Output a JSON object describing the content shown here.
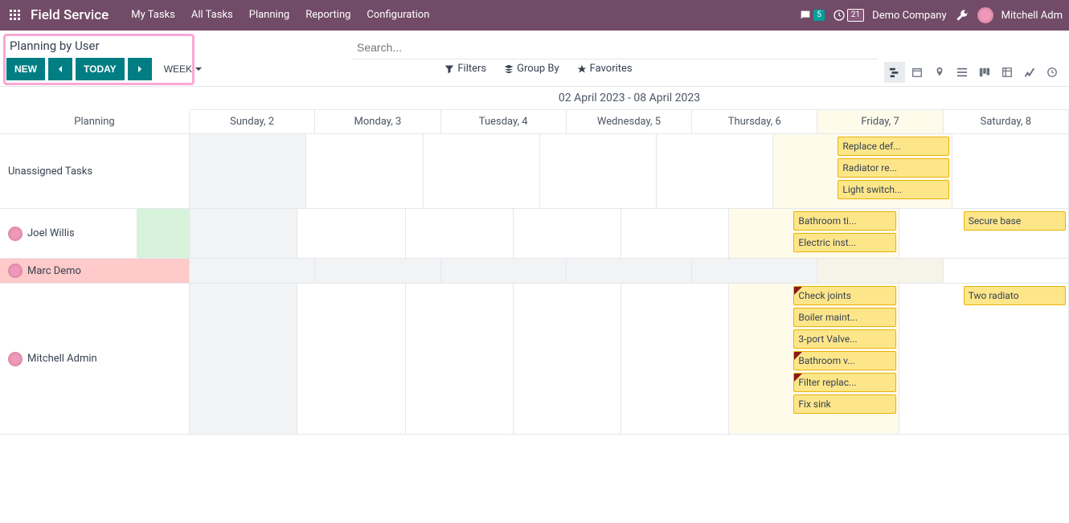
{
  "top": {
    "brand": "Field Service",
    "nav": [
      "My Tasks",
      "All Tasks",
      "Planning",
      "Reporting",
      "Configuration"
    ],
    "chat_count": "5",
    "clock_count": "21",
    "company": "Demo Company",
    "user": "Mitchell Adm"
  },
  "ctrl": {
    "title": "Planning by User",
    "new": "NEW",
    "today": "TODAY",
    "week": "WEEK",
    "search_placeholder": "Search...",
    "filters": "Filters",
    "groupby": "Group By",
    "favorites": "Favorites"
  },
  "grid": {
    "date_range": "02 April 2023 - 08 April 2023",
    "planning_label": "Planning",
    "days": [
      "Sunday, 2",
      "Monday, 3",
      "Tuesday, 4",
      "Wednesday, 5",
      "Thursday, 6",
      "Friday, 7",
      "Saturday, 8"
    ],
    "rows": {
      "unassigned": {
        "label": "Unassigned Tasks",
        "friday": [
          "Replace def...",
          "Radiator re...",
          "Light switch..."
        ]
      },
      "joel": {
        "label": "Joel Willis",
        "friday": [
          "Bathroom ti...",
          "Electric inst..."
        ],
        "saturday": [
          "Secure base"
        ]
      },
      "marc": {
        "label": "Marc Demo"
      },
      "mitchell": {
        "label": "Mitchell Admin",
        "friday": [
          "Check joints",
          "Boiler maint...",
          "3-port Valve...",
          "Bathroom v...",
          "Filter replac...",
          "Fix sink"
        ],
        "saturday": [
          "Two radiato"
        ]
      }
    }
  }
}
